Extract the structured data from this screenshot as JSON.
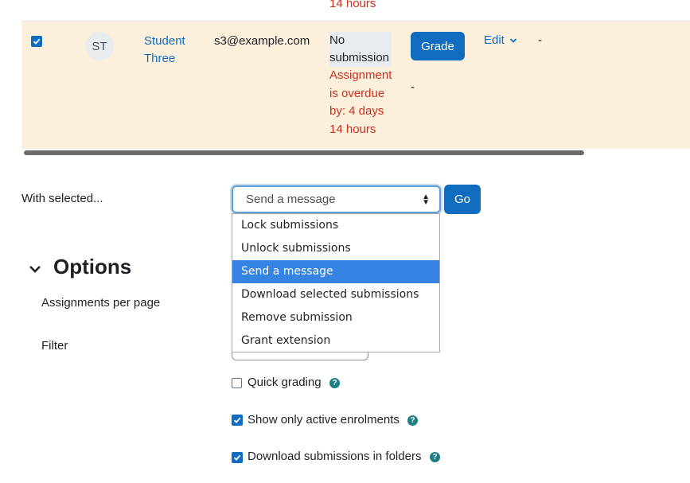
{
  "top_row": {
    "overdue_tail": "14 hours"
  },
  "row": {
    "avatar_initials": "ST",
    "name_line1": "Student",
    "name_line2": "Three",
    "email": "s3@example.com",
    "status_line1": "No",
    "status_line2": "submission",
    "overdue_lines": [
      "Assignment",
      "is overdue",
      "by: 4 days",
      "14 hours"
    ],
    "grade_button": "Grade",
    "edit_label": "Edit",
    "dash_after_edit": "-",
    "dash_grade_col": "-"
  },
  "bulk": {
    "label": "With selected...",
    "select_value": "Send a message",
    "go_button": "Go",
    "options": [
      "Lock submissions",
      "Unlock submissions",
      "Send a message",
      "Download selected submissions",
      "Remove submission",
      "Grant extension"
    ],
    "selected_index": 2
  },
  "options_section": {
    "heading": "Options",
    "assignments_per_page_label": "Assignments per page",
    "filter_label": "Filter",
    "quick_grading": "Quick grading",
    "show_active": "Show only active enrolments",
    "download_folders": "Download submissions in folders",
    "help_glyph": "?"
  },
  "colors": {
    "accent": "#0f6cbf",
    "overdue": "#ca3120",
    "row_highlight": "#fcefdc",
    "dropdown_selected": "#3584e4",
    "help": "#1a7f86"
  }
}
